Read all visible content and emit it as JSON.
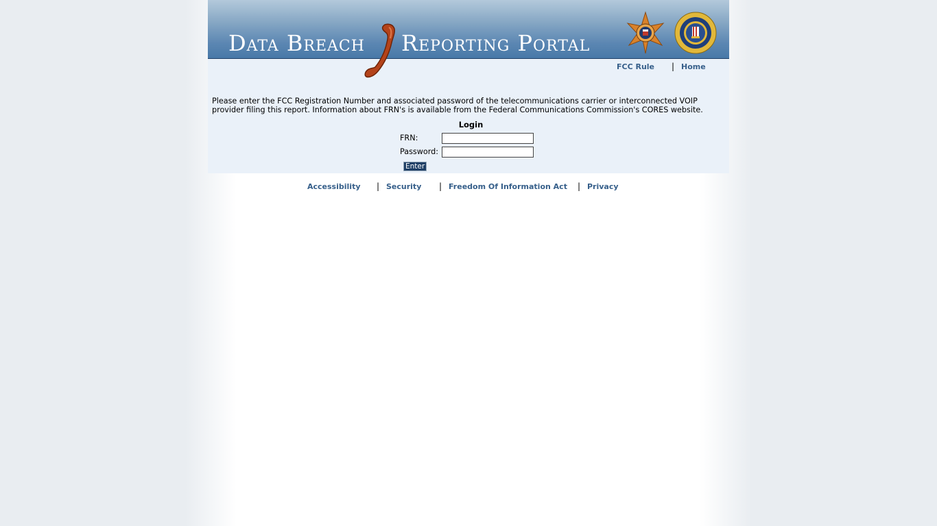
{
  "header": {
    "title_left": "Data Breach",
    "title_right": "Reporting Portal"
  },
  "topnav": {
    "fcc_rule": "FCC Rule",
    "home": "Home",
    "separator": "|"
  },
  "instructions": "Please enter the FCC Registration Number and associated password of the telecommunications carrier or interconnected VOIP provider filing this report. Information about FRN's is available from the Federal Communications Commission's CORES website.",
  "login": {
    "title": "Login",
    "frn_label": "FRN:",
    "frn_value": "",
    "password_label": "Password:",
    "password_value": "",
    "enter_label": "Enter"
  },
  "footer": {
    "accessibility": "Accessibility",
    "security": "Security",
    "foia": "Freedom Of Information Act",
    "privacy": "Privacy",
    "separator": "|"
  },
  "colors": {
    "link": "#365f8a",
    "content_bg": "#eaf1f9",
    "banner_dark": "#4879a8",
    "button_bg": "#1f3f66",
    "phone": "#b4431a"
  },
  "icons": [
    "phone-handset-icon",
    "secret-service-star-icon",
    "fbi-seal-icon"
  ]
}
